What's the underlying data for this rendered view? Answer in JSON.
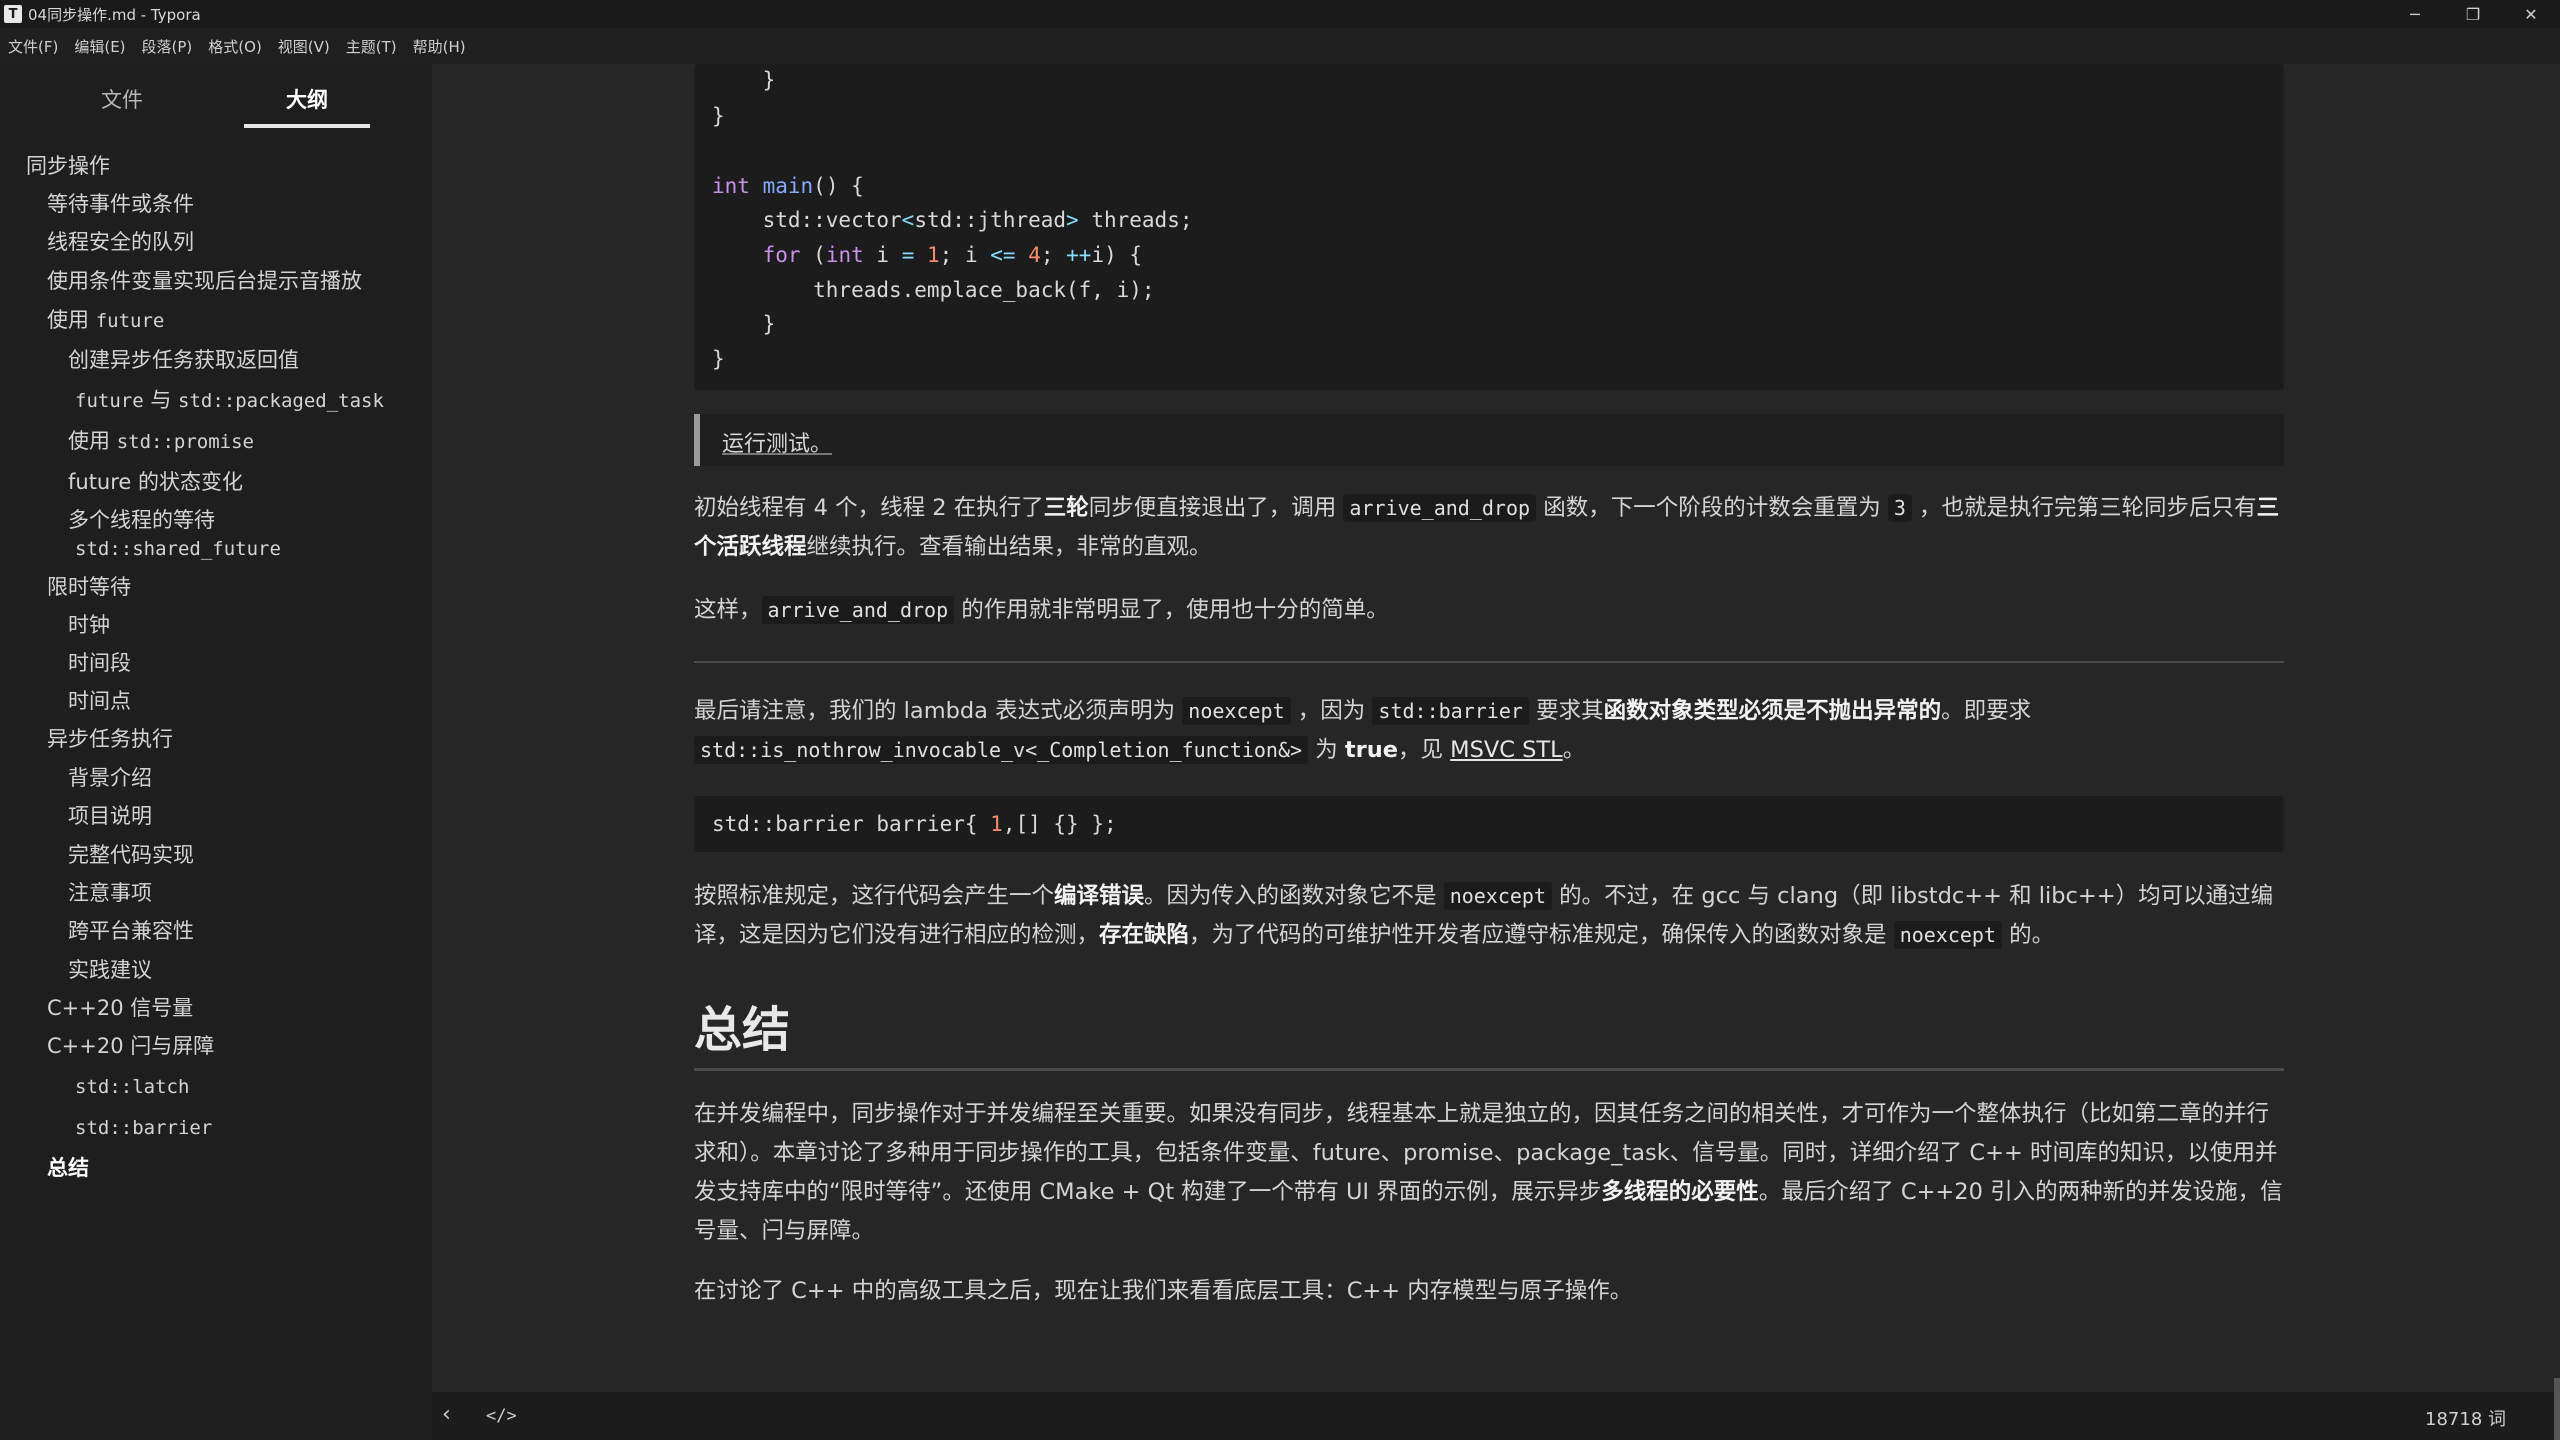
{
  "window": {
    "title": "04同步操作.md - Typora",
    "app_icon_letter": "T",
    "minimize": "─",
    "restore": "❐",
    "close": "✕"
  },
  "menu": [
    "文件(F)",
    "编辑(E)",
    "段落(P)",
    "格式(O)",
    "视图(V)",
    "主题(T)",
    "帮助(H)"
  ],
  "sidebar": {
    "tab_files": "文件",
    "tab_outline": "大纲",
    "outline": [
      {
        "text": "同步操作"
      },
      {
        "text": "等待事件或条件"
      },
      {
        "text": "线程安全的队列"
      },
      {
        "text": "使用条件变量实现后台提示音播放"
      },
      {
        "text": "使用 ",
        "code": "future"
      },
      {
        "text": "创建异步任务获取返回值"
      },
      {
        "code_a": "future",
        "text": " 与 ",
        "code_b": "std::packaged_task"
      },
      {
        "text": "使用 ",
        "code": "std::promise"
      },
      {
        "text": "future 的状态变化"
      },
      {
        "text": "多个线程的等待",
        "code": "std::shared_future"
      },
      {
        "text": "限时等待"
      },
      {
        "text": "时钟"
      },
      {
        "text": "时间段"
      },
      {
        "text": "时间点"
      },
      {
        "text": "异步任务执行"
      },
      {
        "text": "背景介绍"
      },
      {
        "text": "项目说明"
      },
      {
        "text": "完整代码实现"
      },
      {
        "text": "注意事项"
      },
      {
        "text": "跨平台兼容性"
      },
      {
        "text": "实践建议"
      },
      {
        "text": "C++20 信号量"
      },
      {
        "text": "C++20 闩与屏障"
      },
      {
        "code": "std::latch"
      },
      {
        "code": "std::barrier"
      },
      {
        "text": "总结"
      }
    ]
  },
  "content": {
    "code1": {
      "l1": "    }",
      "l2": "}",
      "l3_kw": "int",
      "l3_fn": "main",
      "l3_rest": "() {",
      "l4_a": "    std::vector",
      "l4_op1": "<",
      "l4_b": "std::jthread",
      "l4_op2": ">",
      "l4_c": " threads;",
      "l5_kw1": "for",
      "l5_a": " (",
      "l5_kw2": "int",
      "l5_b": " i ",
      "l5_op1": "=",
      "l5_n1": "1",
      "l5_c": "; i ",
      "l5_op2": "<=",
      "l5_n2": "4",
      "l5_d": "; ",
      "l5_op3": "++",
      "l5_e": "i) {",
      "l6": "        threads.emplace_back(f, i);",
      "l7": "    }",
      "l8": "}"
    },
    "quote": "运行测试。",
    "p1": {
      "a": "初始线程有 4 个，线程 2 在执行了",
      "b1": "三轮",
      "c": "同步便直接退出了，调用 ",
      "code1": "arrive_and_drop",
      "d": " 函数，下一个阶段的计数会重置为 ",
      "code2": "3",
      "e": " ，也就是执行完第三轮同步后只有",
      "b2": "三个活跃线程",
      "f": "继续执行。查看输出结果，非常的直观。"
    },
    "p2": {
      "a": "这样，",
      "code": "arrive_and_drop",
      "b": " 的作用就非常明显了，使用也十分的简单。"
    },
    "p3": {
      "a": "最后请注意，我们的 lambda 表达式必须声明为 ",
      "code1": "noexcept",
      "b": " ，因为 ",
      "code2": "std::barrier",
      "c": " 要求其",
      "bold": "函数对象类型必须是不抛出异常的",
      "d": "。即要求 ",
      "code3": "std::is_nothrow_invocable_v<_Completion_function&>",
      "e": " 为 ",
      "bold2": "true",
      "f": "，见 ",
      "link": "MSVC STL",
      "g": "。"
    },
    "code2": {
      "a": "std::barrier barrier{ ",
      "n": "1",
      "b": ",[] {} };"
    },
    "p4": {
      "a": "按照标准规定，这行代码会产生一个",
      "b1": "编译错误",
      "c": "。因为传入的函数对象它不是 ",
      "code1": "noexcept",
      "d": " 的。不过，在 gcc 与 clang（即 libstdc++ 和 libc++）均可以通过编译，这是因为它们没有进行相应的检测，",
      "b2": "存在缺陷",
      "e": "，为了代码的可维护性开发者应遵守标准规定，确保传入的函数对象是 ",
      "code2": "noexcept",
      "f": " 的。"
    },
    "h1": "总结",
    "p5": {
      "a": "在并发编程中，同步操作对于并发编程至关重要。如果没有同步，线程基本上就是独立的，因其任务之间的相关性，才可作为一个整体执行（比如第二章的并行求和）。本章讨论了多种用于同步操作的工具，包括条件变量、future、promise、package_task、信号量。同时，详细介绍了 C++ 时间库的知识，以使用并发支持库中的“限时等待”。还使用 CMake + Qt 构建了一个带有 UI 界面的示例，展示异步",
      "b": "多线程的必要性",
      "c": "。最后介绍了 C++20 引入的两种新的并发设施，信号量、闩与屏障。"
    },
    "p6": "在讨论了 C++ 中的高级工具之后，现在让我们来看看底层工具：C++ 内存模型与原子操作。"
  },
  "statusbar": {
    "back_icon": "‹",
    "source_icon": "</>",
    "word_count": "18718 词"
  }
}
